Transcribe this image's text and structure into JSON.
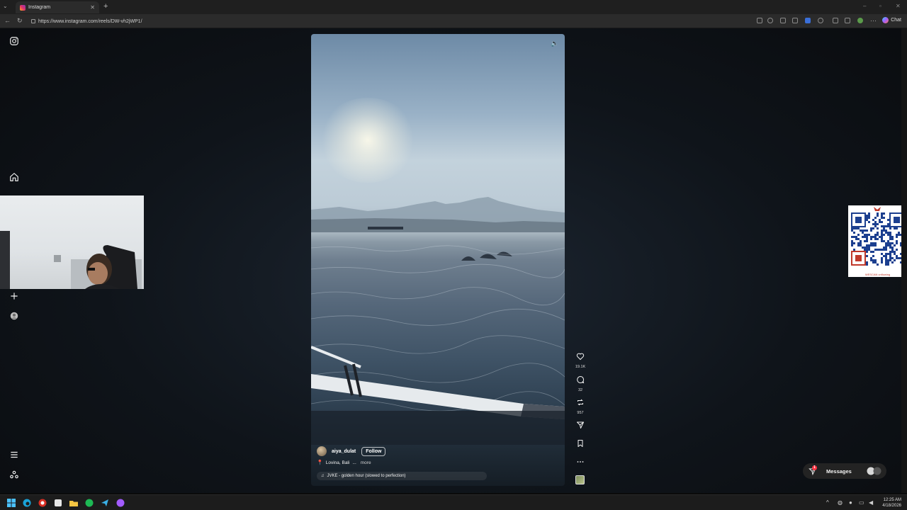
{
  "browser": {
    "tab_title": "Instagram",
    "url": "https://www.instagram.com/reels/DW-vh2jWP1/",
    "chat_label": "Chat"
  },
  "reel": {
    "username": "aiya_dulat",
    "follow_label": "Follow",
    "location": "Lovina, Bali",
    "location_ellipsis": "...",
    "more_label": "more",
    "audio": "JVKE - golden hour (slowed to perfection)"
  },
  "actions": {
    "likes": "19.1K",
    "comments": "32",
    "reposts": "957"
  },
  "qr": {
    "caption": "WESCAN vnflowing"
  },
  "messages": {
    "label": "Messages",
    "badge": "1"
  },
  "taskbar": {
    "time": "12:25 AM",
    "date": "4/18/2026"
  },
  "icons": [
    "instagram-logo-icon",
    "home-icon",
    "plus-icon",
    "profile-icon",
    "menu-icon",
    "meta-icon",
    "heart-icon",
    "comment-icon",
    "repost-icon",
    "share-icon",
    "bookmark-icon",
    "more-icon",
    "mute-icon",
    "location-pin-icon",
    "music-note-icon"
  ]
}
